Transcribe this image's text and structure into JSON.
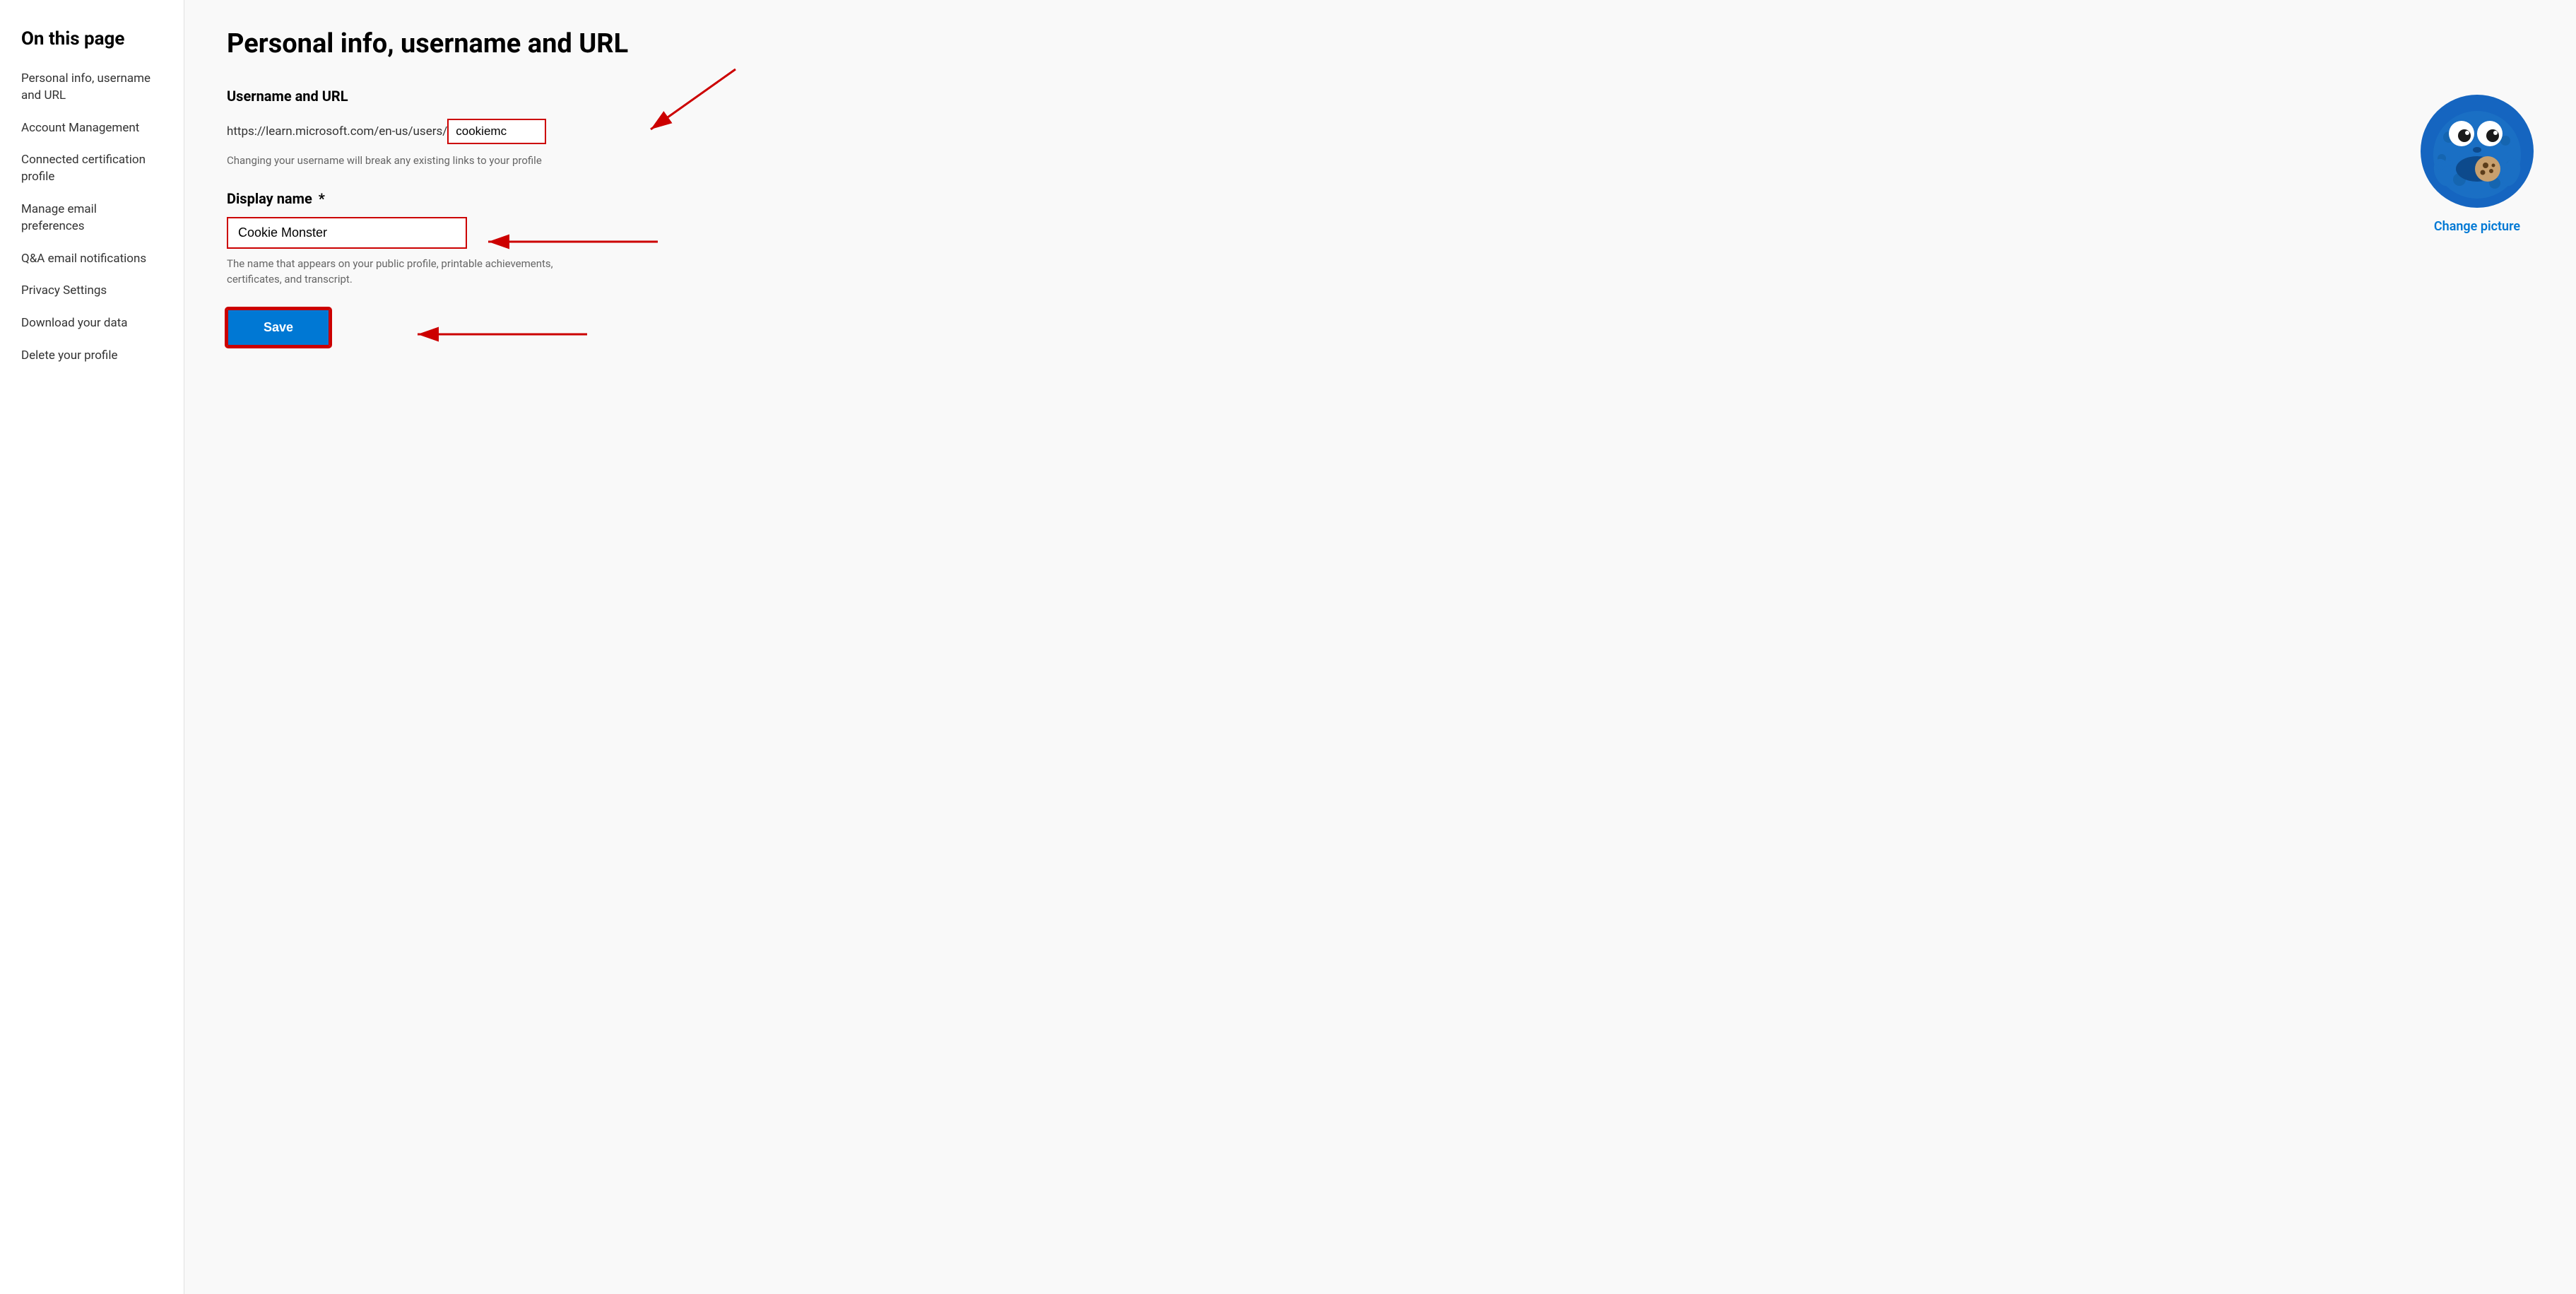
{
  "sidebar": {
    "title": "On this page",
    "items": [
      {
        "label": "Personal info, username and URL",
        "id": "personal-info"
      },
      {
        "label": "Account Management",
        "id": "account-management"
      },
      {
        "label": "Connected certification profile",
        "id": "cert-profile"
      },
      {
        "label": "Manage email preferences",
        "id": "email-prefs"
      },
      {
        "label": "Q&A email notifications",
        "id": "qa-notifications"
      },
      {
        "label": "Privacy Settings",
        "id": "privacy-settings"
      },
      {
        "label": "Download your data",
        "id": "download-data"
      },
      {
        "label": "Delete your profile",
        "id": "delete-profile"
      }
    ]
  },
  "main": {
    "page_title": "Personal info, username and URL",
    "username_url_section": {
      "title": "Username and URL",
      "url_base": "https://learn.microsoft.com/en-us/users/",
      "username_value": "cookiemc",
      "username_hint": "Changing your username will break any existing links to your profile"
    },
    "display_name_section": {
      "title": "Display name",
      "required_marker": "*",
      "input_value": "Cookie Monster",
      "hint": "The name that appears on your public profile, printable achievements, certificates, and transcript."
    },
    "save_button_label": "Save",
    "change_picture_label": "Change picture"
  }
}
